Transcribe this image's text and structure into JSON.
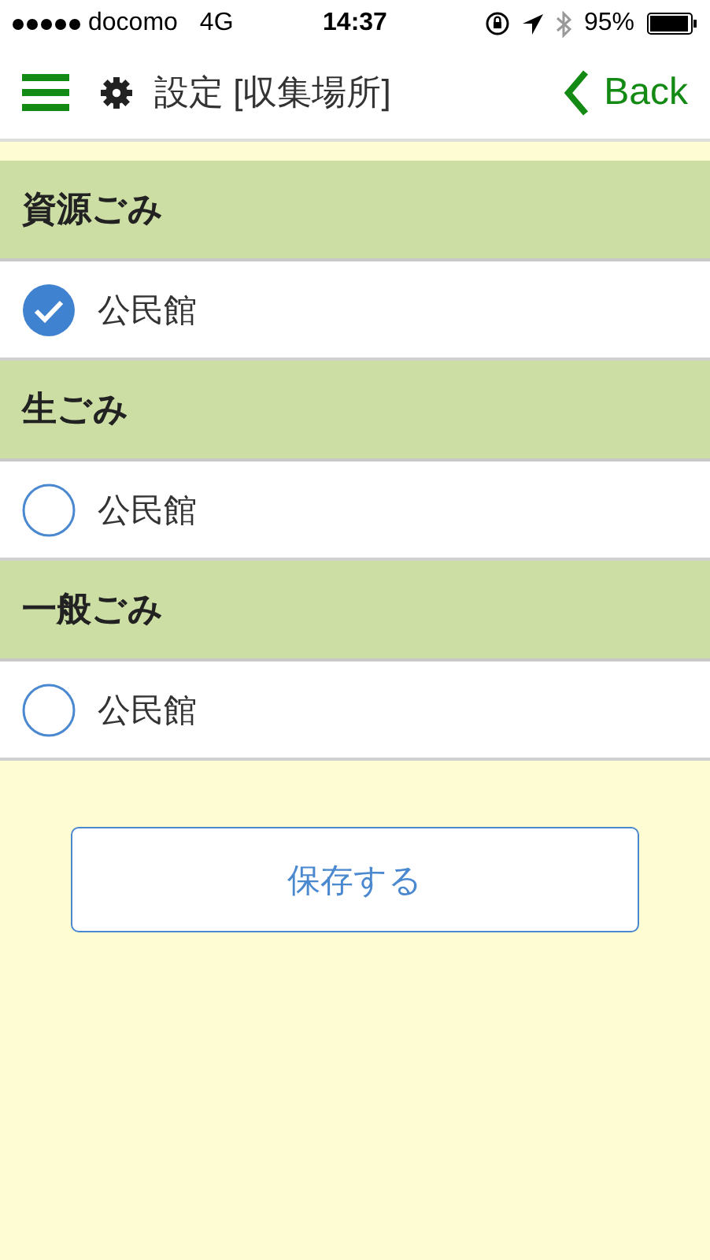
{
  "status_bar": {
    "carrier": "docomo",
    "network": "4G",
    "time": "14:37",
    "battery": "95%"
  },
  "nav_bar": {
    "title": "設定 [収集場所]",
    "back": "Back"
  },
  "sections": [
    {
      "title": "資源ごみ",
      "options": [
        {
          "label": "公民館",
          "selected": true
        }
      ]
    },
    {
      "title": "生ごみ",
      "options": [
        {
          "label": "公民館",
          "selected": false
        }
      ]
    },
    {
      "title": "一般ごみ",
      "options": [
        {
          "label": "公民館",
          "selected": false
        }
      ]
    }
  ],
  "save_button": "保存する"
}
